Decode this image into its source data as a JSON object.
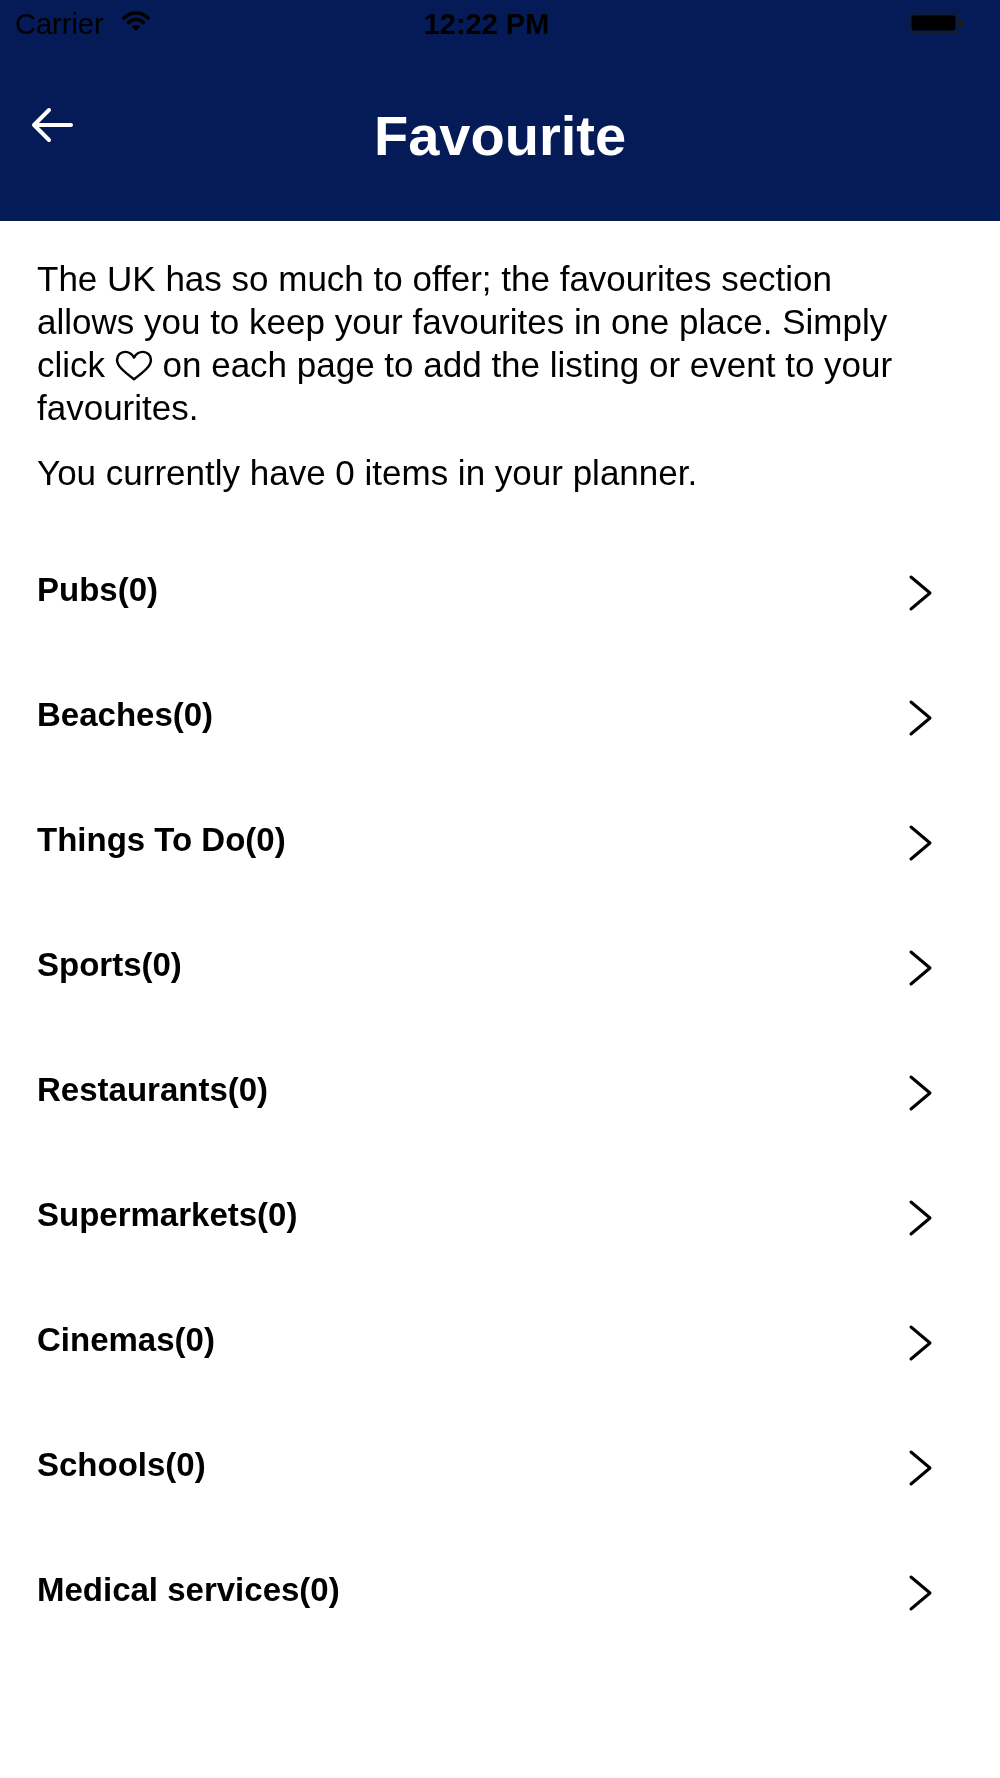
{
  "status_bar": {
    "carrier": "Carrier",
    "time": "12:22 PM"
  },
  "nav_bar": {
    "title": "Favourite"
  },
  "intro": {
    "text_before_icon": "The UK has so much to offer; the favourites section allows you to keep your favourites in one place. Simply click",
    "text_after_icon": "on each page to add the listing or event to your favourites."
  },
  "planner_note": "You currently have 0 items in your planner.",
  "categories": [
    "Pubs(0)",
    "Beaches(0)",
    "Things To Do(0)",
    "Sports(0)",
    "Restaurants(0)",
    "Supermarkets(0)",
    "Cinemas(0)",
    "Schools(0)",
    "Medical services(0)"
  ]
}
